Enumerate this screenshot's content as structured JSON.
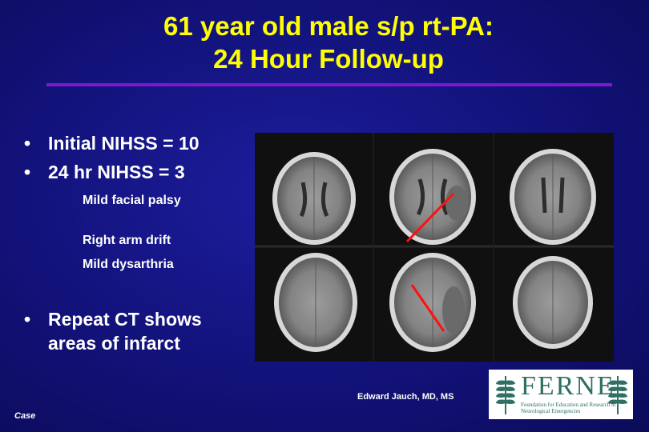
{
  "slide": {
    "title_line1": "61 year old male s/p rt-PA:",
    "title_line2": "24 Hour Follow-up",
    "bullets": [
      {
        "text": "Initial NIHSS = 10"
      },
      {
        "text": "24 hr NIHSS =   3"
      },
      {
        "text_line1": "Repeat CT shows",
        "text_line2": "areas of infarct"
      }
    ],
    "sub_items": [
      "Mild facial palsy",
      "Right arm drift",
      "Mild dysarthria"
    ],
    "credit": "Edward Jauch, MD, MS",
    "footer_label": "Case"
  },
  "logo": {
    "wordmark": "FERNE",
    "tagline": "Foundation for Education and Research in Neurological Emergencies"
  },
  "colors": {
    "background": "#12127a",
    "title": "#ffff00",
    "rule": "#7a1ad0",
    "text": "#ffffff",
    "annotation": "#ff1010",
    "logo": "#2f6f64"
  }
}
